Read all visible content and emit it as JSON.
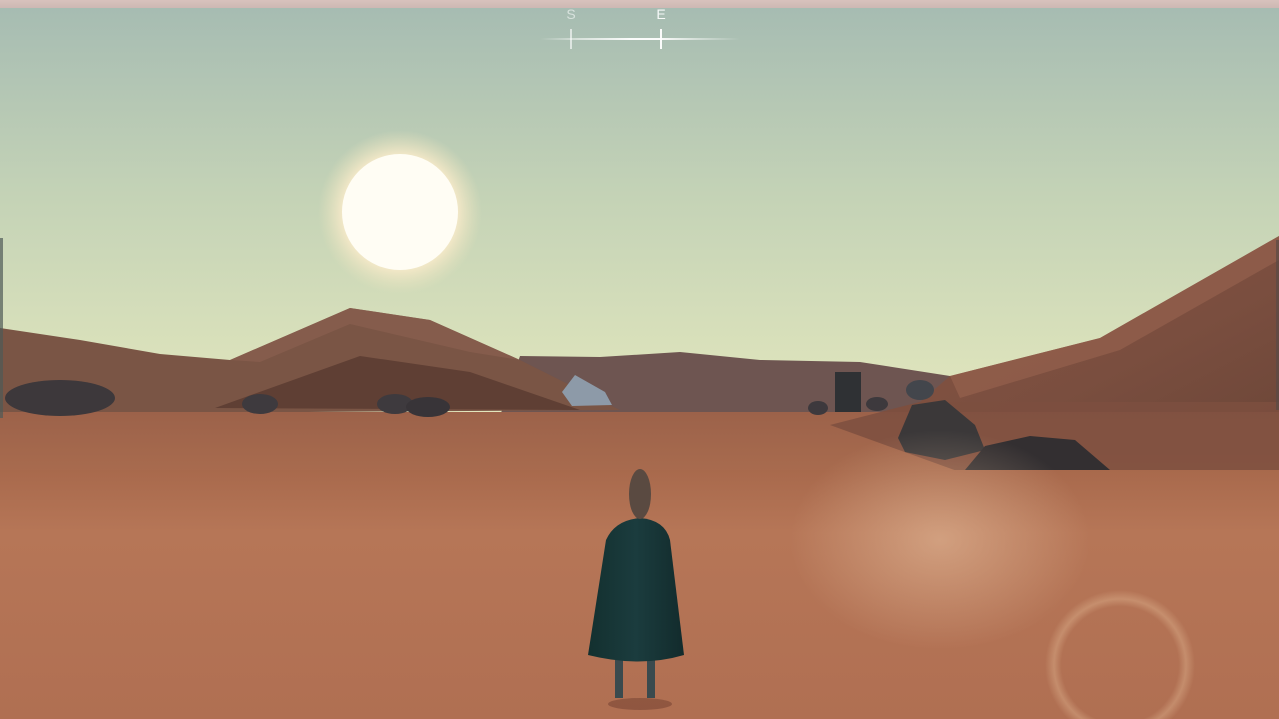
{
  "hud": {
    "compass": {
      "visible_headings": [
        "S",
        "E"
      ],
      "active_heading": "E"
    }
  },
  "scene": {
    "environment": "desert",
    "time_of_day": "sun low in sky",
    "colors": {
      "sky_top": "#a4bcb3",
      "sky_horizon": "#e2e6bd",
      "sand_near": "#b87657",
      "sand_mid": "#a8684b",
      "dune_far": "#6f5650",
      "rock": "#3e3b3f",
      "cloak": "#17363a"
    }
  }
}
